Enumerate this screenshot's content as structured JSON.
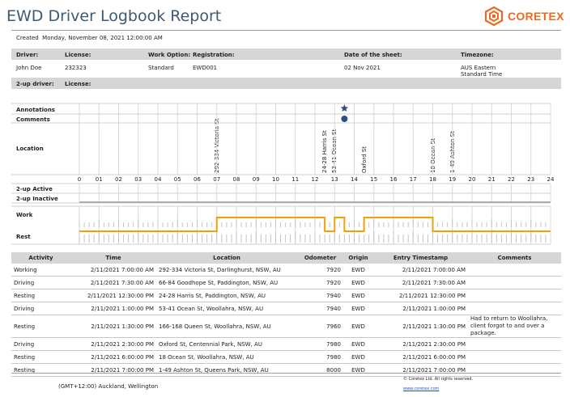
{
  "header": {
    "title": "EWD Driver Logbook Report",
    "logo_text": "CORETEX",
    "brand_color": "#ea6a1f",
    "created_label": "Created",
    "created_value": "Monday, November 08, 2021 12:00:00 AM"
  },
  "info": {
    "driver_label": "Driver:",
    "license_label": "License:",
    "work_option_label": "Work Option:",
    "registration_label": "Registration:",
    "date_label": "Date of the sheet:",
    "timezone_label": "Timezone:",
    "driver": "John Doe",
    "license": "232323",
    "work_option": "Standard",
    "registration": "EWD001",
    "date": "02 Nov 2021",
    "timezone_line1": "AUS Eastern",
    "timezone_line2": "Standard Time",
    "twoup_driver_label": "2-up driver:",
    "twoup_license_label": "License:"
  },
  "chart_data": {
    "type": "logbook",
    "row_labels": {
      "annotations": "Annotations",
      "comments": "Comments",
      "location": "Location",
      "twoup_active": "2-up Active",
      "twoup_inactive": "2-up Inactive",
      "work": "Work",
      "rest": "Rest"
    },
    "hour_ticks": [
      "0",
      "01",
      "02",
      "03",
      "04",
      "05",
      "06",
      "07",
      "08",
      "09",
      "10",
      "11",
      "12",
      "13",
      "14",
      "15",
      "16",
      "17",
      "18",
      "19",
      "20",
      "21",
      "22",
      "23",
      "24"
    ],
    "x_range_hours": [
      0,
      24
    ],
    "annotation_hour": 13.5,
    "comment_hour": 13.5,
    "locations": [
      {
        "hour": 7.0,
        "label": "292-334 Victoria St"
      },
      {
        "hour": 12.5,
        "label": "24-28 Harris St"
      },
      {
        "hour": 13.0,
        "label": "53-41 Ocean St"
      },
      {
        "hour": 14.5,
        "label": "Oxford St"
      },
      {
        "hour": 18.0,
        "label": "18 Ocean St"
      },
      {
        "hour": 19.0,
        "label": "1-49 Ashton St"
      }
    ],
    "status_segments": [
      {
        "start": 0.0,
        "end": 7.0,
        "status": "rest"
      },
      {
        "start": 7.0,
        "end": 12.5,
        "status": "work"
      },
      {
        "start": 12.5,
        "end": 13.0,
        "status": "rest"
      },
      {
        "start": 13.0,
        "end": 13.5,
        "status": "work"
      },
      {
        "start": 13.5,
        "end": 14.5,
        "status": "rest"
      },
      {
        "start": 14.5,
        "end": 18.0,
        "status": "work"
      },
      {
        "start": 18.0,
        "end": 24.0,
        "status": "rest"
      }
    ],
    "line_color": "#f2a007",
    "annotation_color": "#2f4f7f"
  },
  "table": {
    "headers": [
      "Activity",
      "Time",
      "Location",
      "Odometer",
      "Origin",
      "Entry Timestamp",
      "Comments"
    ],
    "rows": [
      [
        "Working",
        "2/11/2021 7:00:00 AM",
        "292-334 Victoria St, Darlinghurst, NSW, AU",
        "7920",
        "EWD",
        "2/11/2021 7:00:00 AM",
        ""
      ],
      [
        "Driving",
        "2/11/2021 7:30:00 AM",
        "66-84 Goodhope St, Paddington, NSW, AU",
        "7920",
        "EWD",
        "2/11/2021 7:30:00 AM",
        ""
      ],
      [
        "Resting",
        "2/11/2021 12:30:00 PM",
        "24-28 Harris St, Paddington, NSW, AU",
        "7940",
        "EWD",
        "2/11/2021 12:30:00 PM",
        ""
      ],
      [
        "Driving",
        "2/11/2021 1:00:00 PM",
        "53-41 Ocean St, Woollahra, NSW, AU",
        "7940",
        "EWD",
        "2/11/2021 1:00:00 PM",
        ""
      ],
      [
        "Resting",
        "2/11/2021 1:30:00 PM",
        "166-168 Queen St, Woollahra, NSW, AU",
        "7960",
        "EWD",
        "2/11/2021 1:30:00 PM",
        "Had to return to Woollahra, client forgot to and over a package."
      ],
      [
        "Driving",
        "2/11/2021 2:30:00 PM",
        "Oxford St, Centennial Park, NSW, AU",
        "7980",
        "EWD",
        "2/11/2021 2:30:00 PM",
        ""
      ],
      [
        "Resting",
        "2/11/2021 6:00:00 PM",
        "18 Ocean St, Woollahra, NSW, AU",
        "7980",
        "EWD",
        "2/11/2021 6:00:00 PM",
        ""
      ],
      [
        "Resting",
        "2/11/2021 7:00:00 PM",
        "1-49 Ashton St, Queens Park, NSW, AU",
        "8000",
        "EWD",
        "2/11/2021 7:00:00 PM",
        ""
      ]
    ]
  },
  "footer": {
    "timezone": "(GMT+12:00) Auckland, Wellington",
    "copyright": "© Coretex Ltd. All rights reserved.",
    "link": "www.coretex.com"
  }
}
